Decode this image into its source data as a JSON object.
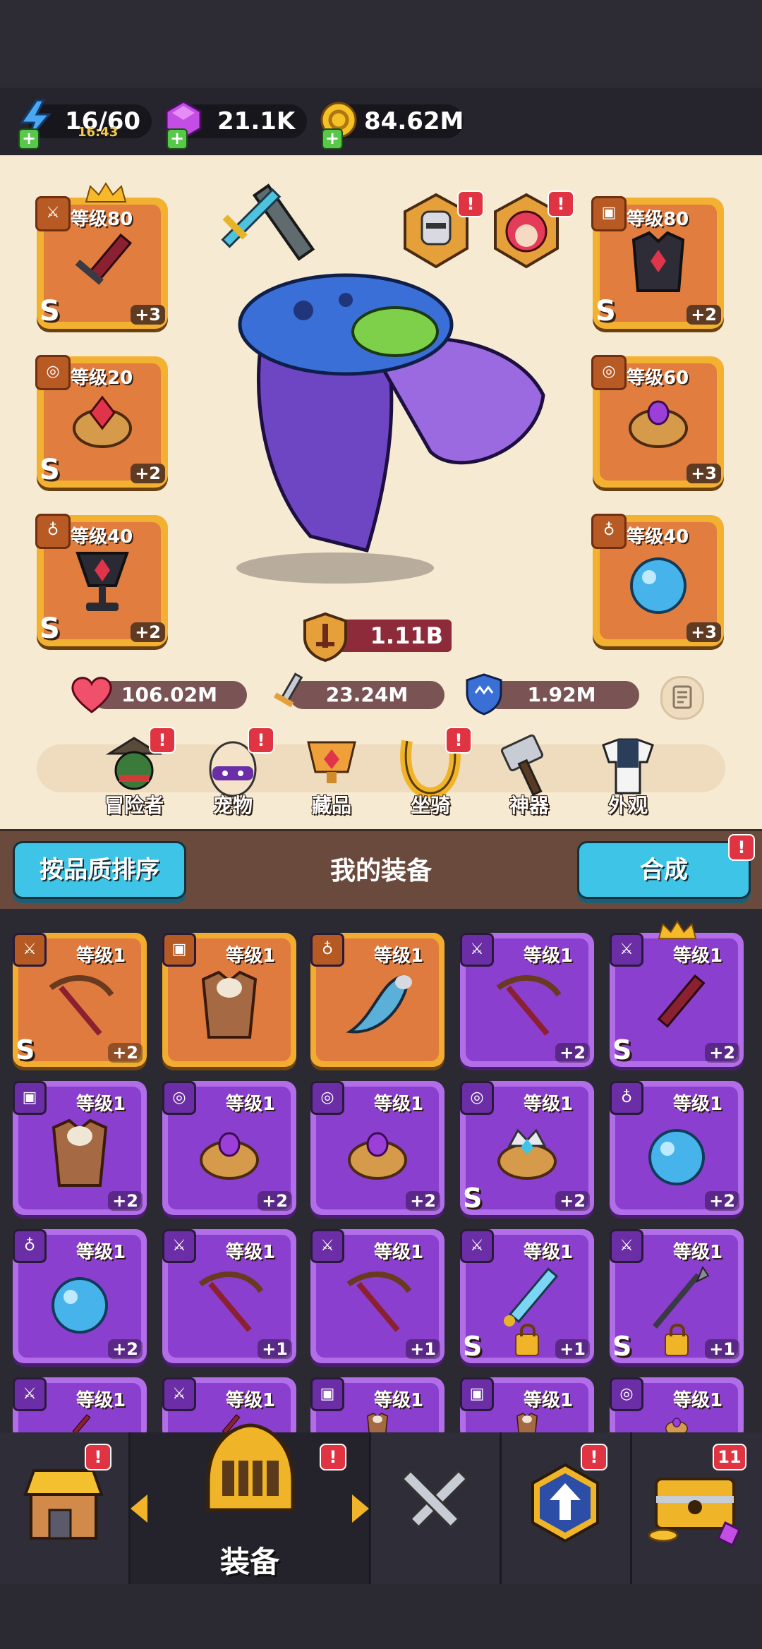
{
  "resources": {
    "energy": {
      "value": "16/60",
      "timer": "16:43"
    },
    "gems": {
      "value": "21.1K"
    },
    "gold": {
      "value": "84.62M"
    }
  },
  "hero": {
    "power": "1.11B",
    "stats": {
      "hp": "106.02M",
      "attack": "23.24M",
      "defense": "1.92M"
    },
    "left_slots": [
      {
        "level": "等级80",
        "grade": "S",
        "plus": "+3",
        "item": "sword"
      },
      {
        "level": "等级20",
        "grade": "S",
        "plus": "+2",
        "item": "ring"
      },
      {
        "level": "等级40",
        "grade": "S",
        "plus": "+2",
        "item": "goblet"
      }
    ],
    "right_slots": [
      {
        "level": "等级80",
        "grade": "S",
        "plus": "+2",
        "item": "armor"
      },
      {
        "level": "等级60",
        "grade": "",
        "plus": "+3",
        "item": "ring"
      },
      {
        "level": "等级40",
        "grade": "",
        "plus": "+3",
        "item": "orb"
      }
    ]
  },
  "nav": {
    "items": [
      {
        "label": "冒险者",
        "badge": "!"
      },
      {
        "label": "宠物",
        "badge": "!"
      },
      {
        "label": "藏品",
        "badge": ""
      },
      {
        "label": "坐骑",
        "badge": "!"
      },
      {
        "label": "神器",
        "badge": ""
      },
      {
        "label": "外观",
        "badge": ""
      }
    ]
  },
  "equipment": {
    "sort_label": "按品质排序",
    "title": "我的装备",
    "merge_label": "合成",
    "merge_badge": "!",
    "rows": [
      [
        {
          "color": "orange",
          "level": "等级1",
          "grade": "S",
          "plus": "+2",
          "item": "crossbow",
          "locked": false
        },
        {
          "color": "orange",
          "level": "等级1",
          "grade": "",
          "plus": "",
          "item": "armor",
          "locked": false
        },
        {
          "color": "orange",
          "level": "等级1",
          "grade": "",
          "plus": "",
          "item": "horn",
          "locked": false
        },
        {
          "color": "purple",
          "level": "等级1",
          "grade": "",
          "plus": "+2",
          "item": "crossbow",
          "locked": false
        },
        {
          "color": "purple",
          "level": "等级1",
          "grade": "S",
          "plus": "+2",
          "item": "sword",
          "locked": false
        }
      ],
      [
        {
          "color": "purple",
          "level": "等级1",
          "grade": "",
          "plus": "+2",
          "item": "armor",
          "locked": false
        },
        {
          "color": "purple",
          "level": "等级1",
          "grade": "",
          "plus": "+2",
          "item": "ring",
          "locked": false
        },
        {
          "color": "purple",
          "level": "等级1",
          "grade": "",
          "plus": "+2",
          "item": "ring",
          "locked": false
        },
        {
          "color": "purple",
          "level": "等级1",
          "grade": "S",
          "plus": "+2",
          "item": "crown-ring",
          "locked": false
        },
        {
          "color": "purple",
          "level": "等级1",
          "grade": "",
          "plus": "+2",
          "item": "orb",
          "locked": false
        }
      ],
      [
        {
          "color": "purple",
          "level": "等级1",
          "grade": "",
          "plus": "+2",
          "item": "orb",
          "locked": false
        },
        {
          "color": "purple",
          "level": "等级1",
          "grade": "",
          "plus": "+1",
          "item": "crossbow",
          "locked": false
        },
        {
          "color": "purple",
          "level": "等级1",
          "grade": "",
          "plus": "+1",
          "item": "crossbow",
          "locked": false
        },
        {
          "color": "purple",
          "level": "等级1",
          "grade": "S",
          "plus": "+1",
          "item": "ice-sword",
          "locked": true
        },
        {
          "color": "purple",
          "level": "等级1",
          "grade": "S",
          "plus": "+1",
          "item": "spear",
          "locked": true
        }
      ],
      [
        {
          "color": "purple",
          "level": "等级1",
          "grade": "",
          "plus": "",
          "item": "sword",
          "locked": false
        },
        {
          "color": "purple",
          "level": "等级1",
          "grade": "",
          "plus": "",
          "item": "sword",
          "locked": false
        },
        {
          "color": "purple",
          "level": "等级1",
          "grade": "",
          "plus": "",
          "item": "armor",
          "locked": false
        },
        {
          "color": "purple",
          "level": "等级1",
          "grade": "",
          "plus": "",
          "item": "armor",
          "locked": false
        },
        {
          "color": "purple",
          "level": "等级1",
          "grade": "",
          "plus": "",
          "item": "ring",
          "locked": false
        }
      ]
    ]
  },
  "bottom_nav": {
    "shop_badge": "!",
    "equip_label": "装备",
    "equip_badge": "!",
    "upgrade_badge": "!",
    "chest_badge": "11"
  },
  "colors": {
    "accent_cyan": "#3ec4e6",
    "badge_red": "#e03443",
    "power_ribbon": "#8e2b3a"
  }
}
